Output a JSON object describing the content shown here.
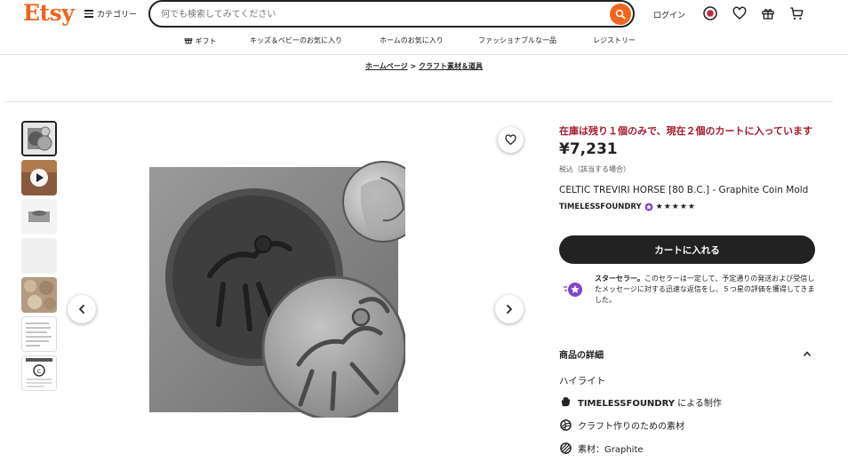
{
  "header": {
    "logo": "Etsy",
    "categories_label": "カテゴリー",
    "search_placeholder": "何でも検索してみてください",
    "login_label": "ログイン"
  },
  "nav": {
    "items": [
      "ギフト",
      "キッズ＆ベビーのお気に入り",
      "ホームのお気に入り",
      "ファッショナブルな一品",
      "レジストリー"
    ]
  },
  "breadcrumb": {
    "home": "ホームページ",
    "separator": ">",
    "category": "クラフト素材＆道具"
  },
  "thumbnails": [
    {
      "name": "coin-mold-photo",
      "selected": true
    },
    {
      "name": "video",
      "selected": false
    },
    {
      "name": "mold-side-view",
      "selected": false
    },
    {
      "name": "blank",
      "selected": false
    },
    {
      "name": "coin-pile",
      "selected": false
    },
    {
      "name": "description-note",
      "selected": false
    },
    {
      "name": "copyright-notice",
      "selected": false
    }
  ],
  "product": {
    "stock_notice": "在庫は残り１個のみで、現在２個のカートに入っています",
    "price": "¥7,231",
    "tax_note": "税込（該当する場合）",
    "title": "CELTIC TREVIRI HORSE [80 B.C.] - Graphite Coin Mold",
    "shop_name": "TIMELESSFOUNDRY",
    "stars": "★★★★★",
    "rating": 5,
    "add_to_cart": "カートに入れる",
    "star_seller_bold": "スターセラー。",
    "star_seller_text": "このセラーは一定して、予定通りの発送および受信したメッセージに対する迅速な返信をし、５つ星の評価を獲得してきました。",
    "details_label": "商品の詳細",
    "highlights_label": "ハイライト",
    "highlights": [
      {
        "bold": "TIMELESSFOUNDRY",
        "text": " による制作",
        "icon": "hand-icon"
      },
      {
        "bold": "",
        "text": "クラフト作りのための素材",
        "icon": "yarn-icon"
      },
      {
        "bold": "",
        "text": "素材：Graphite",
        "icon": "material-icon"
      }
    ]
  },
  "colors": {
    "brand": "#f1641e",
    "stock_red": "#a61a2e",
    "star_seller_purple": "#7f45d0"
  }
}
